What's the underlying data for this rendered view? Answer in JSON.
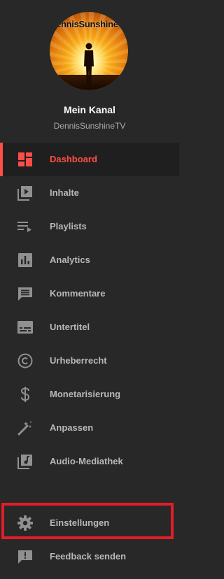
{
  "channel": {
    "avatar_text": "DennisSunshineTV",
    "title": "Mein Kanal",
    "handle": "DennisSunshineTV"
  },
  "nav": {
    "items": [
      {
        "label": "Dashboard",
        "icon": "dashboard-icon"
      },
      {
        "label": "Inhalte",
        "icon": "content-icon"
      },
      {
        "label": "Playlists",
        "icon": "playlist-icon"
      },
      {
        "label": "Analytics",
        "icon": "analytics-icon"
      },
      {
        "label": "Kommentare",
        "icon": "comment-icon"
      },
      {
        "label": "Untertitel",
        "icon": "subtitles-icon"
      },
      {
        "label": "Urheberrecht",
        "icon": "copyright-icon"
      },
      {
        "label": "Monetarisierung",
        "icon": "dollar-icon"
      },
      {
        "label": "Anpassen",
        "icon": "magic-wand-icon"
      },
      {
        "label": "Audio-Mediathek",
        "icon": "audio-library-icon"
      }
    ],
    "active": "Dashboard"
  },
  "bottom": {
    "items": [
      {
        "label": "Einstellungen",
        "icon": "gear-icon"
      },
      {
        "label": "Feedback senden",
        "icon": "feedback-icon"
      }
    ]
  },
  "colors": {
    "background": "#282828",
    "active_accent": "#ff4e45",
    "highlight_box": "#e11e26",
    "text": "#b8b8b8",
    "icon": "#909090"
  }
}
